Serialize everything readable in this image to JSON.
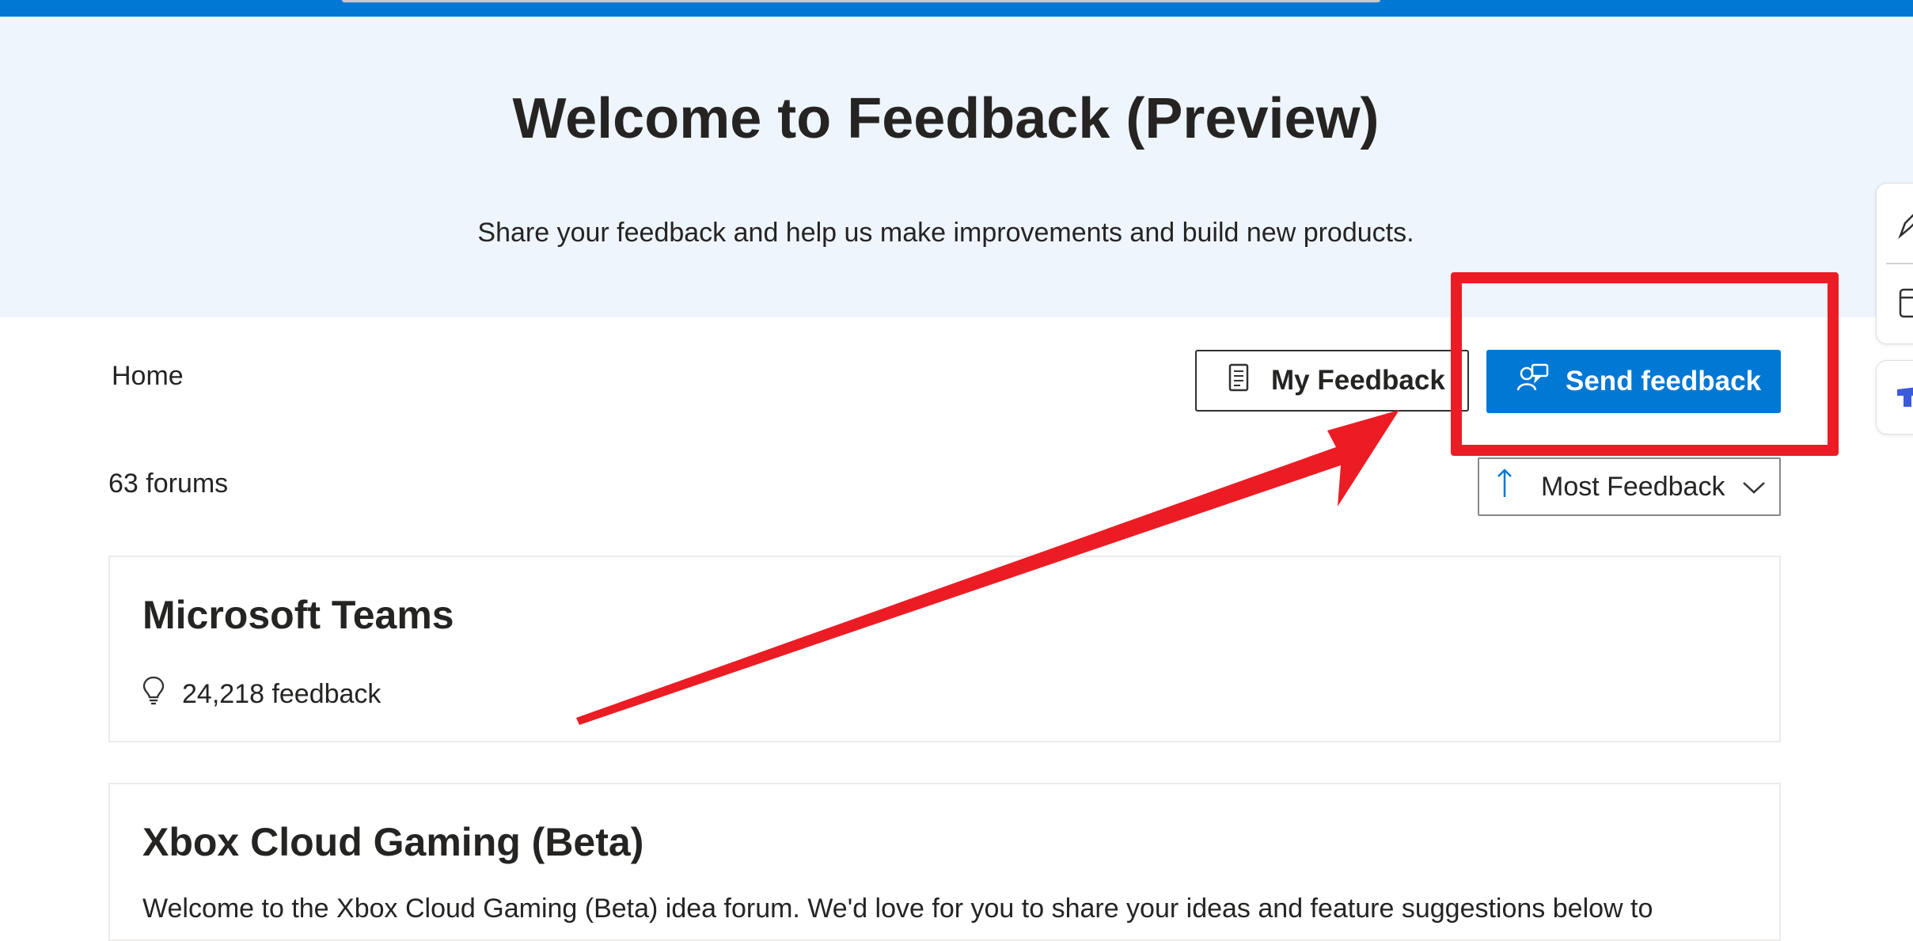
{
  "hero": {
    "title": "Welcome to Feedback (Preview)",
    "subtitle": "Share your feedback and help us make improvements and build new products."
  },
  "nav": {
    "home_label": "Home",
    "my_feedback_label": "My Feedback",
    "send_feedback_label": "Send feedback"
  },
  "forums": {
    "count_label": "63 forums",
    "sort": {
      "selected": "Most Feedback"
    },
    "items": [
      {
        "title": "Microsoft Teams",
        "feedback_count": "24,218 feedback"
      },
      {
        "title": "Xbox Cloud Gaming (Beta)",
        "description": "Welcome to the Xbox Cloud Gaming (Beta) idea forum. We'd love for you to share your ideas and feature suggestions below to"
      }
    ]
  },
  "colors": {
    "accent": "#0078d4",
    "hero_bg": "#eef5fd",
    "annotation_red": "#ec1c24"
  },
  "icons": {
    "my_feedback": "document-list-icon",
    "send_feedback": "person-feedback-icon",
    "sort": "arrow-up-icon",
    "dropdown": "chevron-down-icon",
    "feedback_count": "lightbulb-icon"
  }
}
